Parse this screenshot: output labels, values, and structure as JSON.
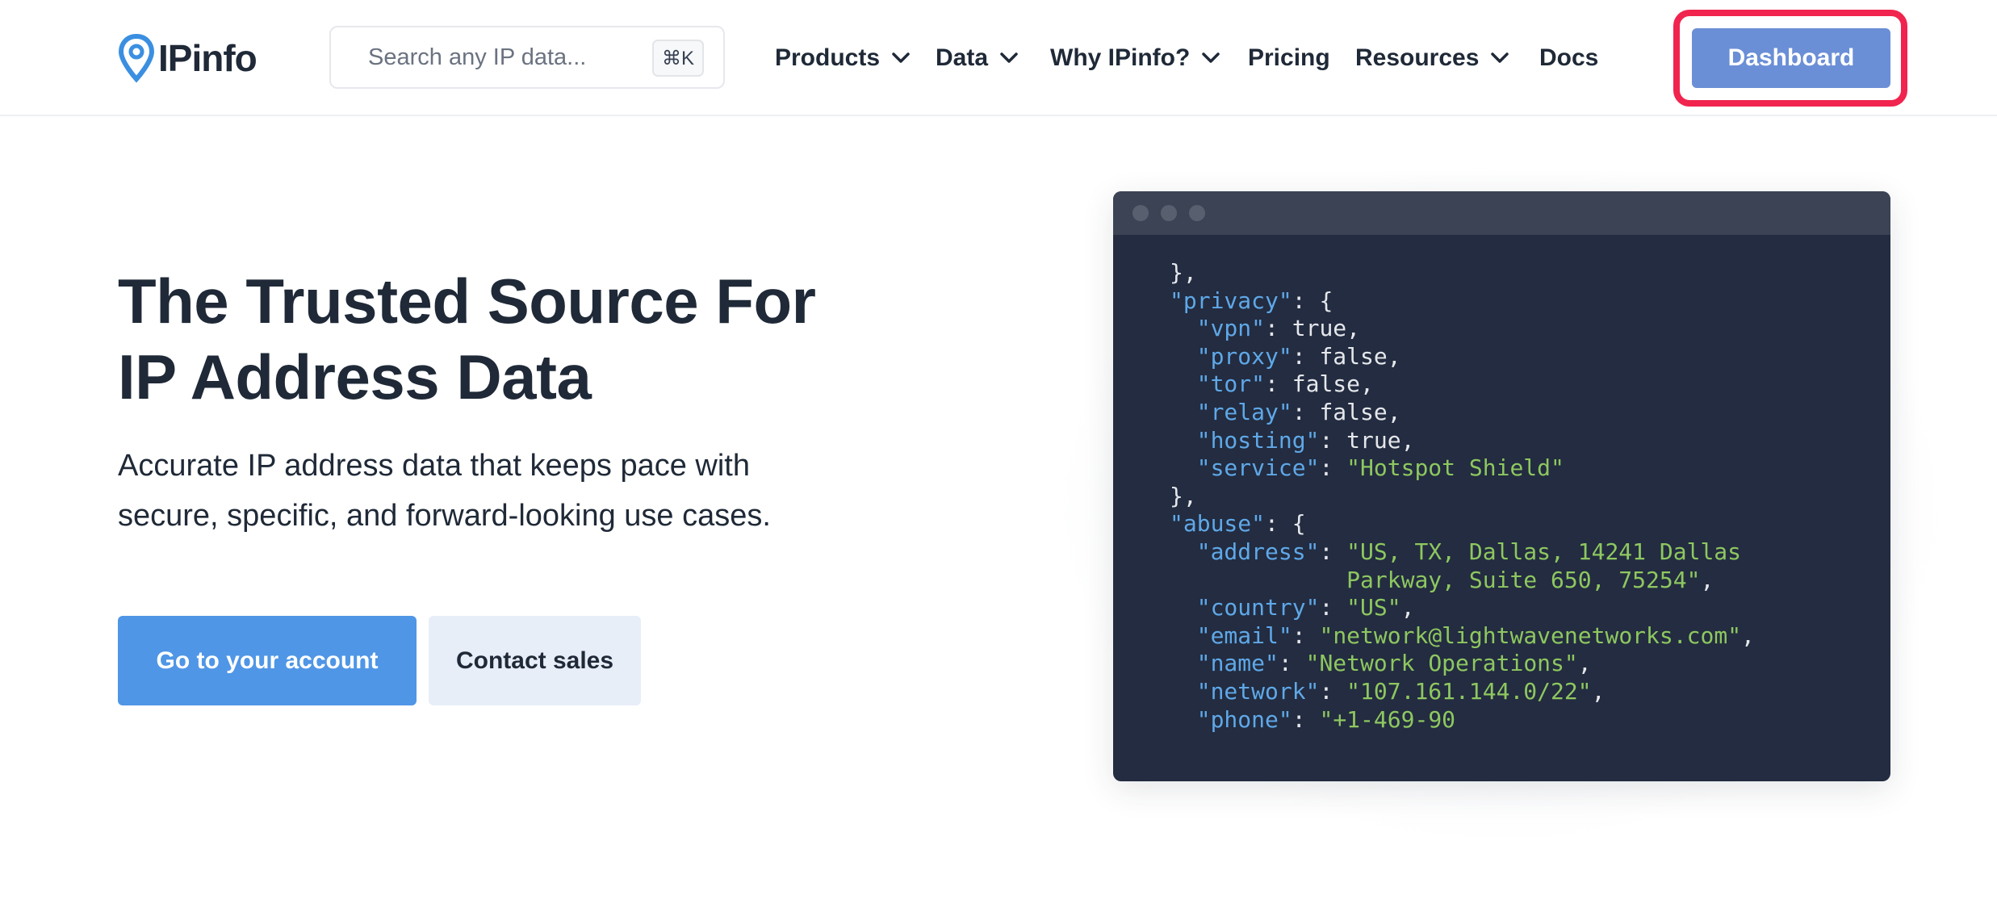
{
  "header": {
    "logo_text": "IPinfo",
    "search": {
      "placeholder": "Search any IP data...",
      "shortcut": "⌘K"
    },
    "nav": [
      {
        "label": "Products",
        "dropdown": true
      },
      {
        "label": "Data",
        "dropdown": true
      },
      {
        "label": "Why IPinfo?",
        "dropdown": true
      },
      {
        "label": "Pricing",
        "dropdown": false
      },
      {
        "label": "Resources",
        "dropdown": true
      },
      {
        "label": "Docs",
        "dropdown": false
      }
    ],
    "dashboard_label": "Dashboard"
  },
  "hero": {
    "title_line1": "The Trusted Source For",
    "title_line2": "IP Address Data",
    "subtitle_line1": "Accurate IP address data that keeps pace with",
    "subtitle_line2": "secure, specific, and forward-looking use cases.",
    "primary_button": "Go to your account",
    "secondary_button": "Contact sales"
  },
  "code_sample": {
    "privacy_key": "privacy",
    "vpn": "true",
    "proxy": "false",
    "tor": "false",
    "relay": "false",
    "hosting": "true",
    "service": "Hotspot Shield",
    "abuse_key": "abuse",
    "address_line1": "US, TX, Dallas, 14241 Dallas",
    "address_line2": "Parkway, Suite 650, 75254",
    "country": "US",
    "email": "network@lightwavenetworks.com",
    "name": "Network Operations",
    "network": "107.161.144.0/22",
    "phone_partial": "+1-469-90"
  },
  "colors": {
    "accent": "#4f96e6",
    "dashboard_button": "#6b8fd6",
    "highlight": "#f0244e",
    "code_bg": "#232c40",
    "code_key": "#5fa8e8",
    "code_string": "#8ec760"
  }
}
